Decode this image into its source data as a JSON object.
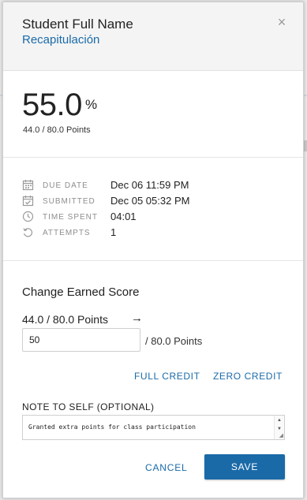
{
  "header": {
    "student_name": "Student Full Name",
    "assignment_title": "Recapitulación",
    "close_icon": "×"
  },
  "score": {
    "value": "55.0",
    "percent_symbol": "%",
    "points": "44.0 / 80.0 Points"
  },
  "info": {
    "due_date": {
      "label": "DUE DATE",
      "value": "Dec 06 11:59 PM",
      "icon": "calendar-icon"
    },
    "submitted": {
      "label": "SUBMITTED",
      "value": "Dec 05 05:32 PM",
      "icon": "calendar-check-icon"
    },
    "time_spent": {
      "label": "TIME SPENT",
      "value": "04:01",
      "icon": "clock-icon"
    },
    "attempts": {
      "label": "ATTEMPTS",
      "value": "1",
      "icon": "refresh-icon"
    }
  },
  "edit": {
    "title": "Change Earned Score",
    "current_score": "44.0 / 80.0 Points",
    "arrow": "→",
    "input_value": "50",
    "input_suffix": "/ 80.0 Points",
    "full_credit_label": "FULL CREDIT",
    "zero_credit_label": "ZERO CREDIT",
    "note_label": "NOTE TO SELF (OPTIONAL)",
    "note_text": "Granted extra points for class participation",
    "cancel_label": "CANCEL",
    "save_label": "SAVE"
  },
  "colors": {
    "accent": "#1a6aa8",
    "header_bg": "#f4f4f4",
    "muted_text": "#8e8e8e"
  }
}
